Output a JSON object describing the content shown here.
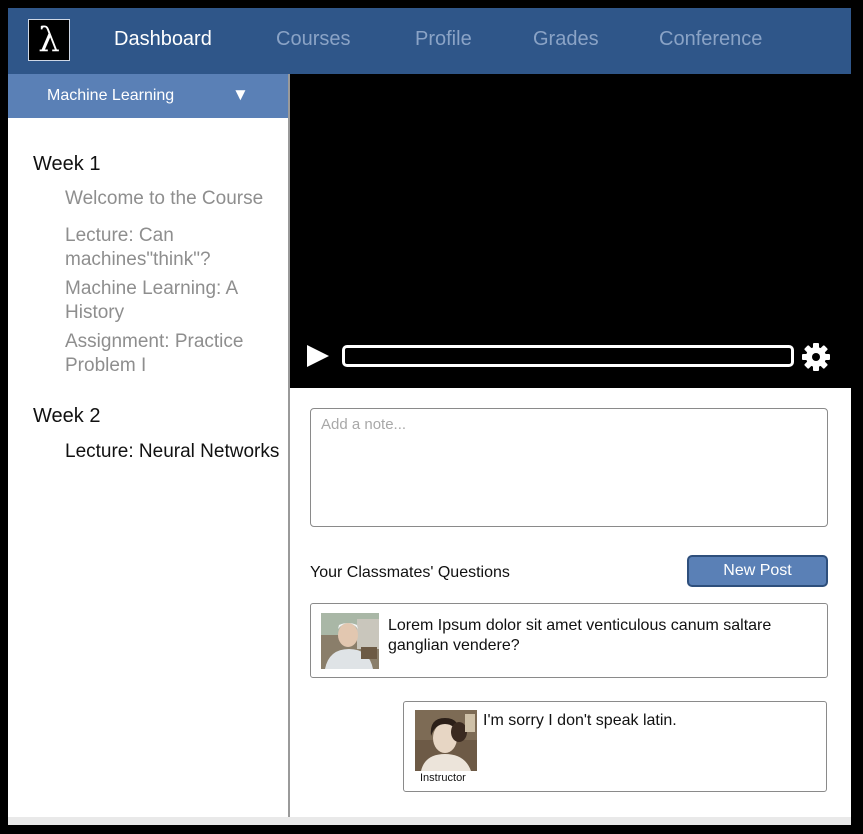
{
  "nav": {
    "logo": "λ",
    "items": [
      {
        "label": "Dashboard"
      },
      {
        "label": "Courses"
      },
      {
        "label": "Profile"
      },
      {
        "label": "Grades"
      },
      {
        "label": "Conference"
      }
    ],
    "active_color": "#ffffff",
    "inactive_color": "#8aa3c6",
    "bar_color": "#2f5689"
  },
  "sidebar": {
    "course_select": {
      "label": "Machine Learning",
      "caret": "▼"
    },
    "weeks": [
      {
        "title": "Week 1",
        "lessons": [
          {
            "title": "Welcome to the Course"
          },
          {
            "title": "Lecture: Can machines\"think\"?"
          },
          {
            "title": "Machine Learning: A History"
          },
          {
            "title": "Assignment: Practice Problem I"
          }
        ]
      },
      {
        "title": "Week 2",
        "lessons": [
          {
            "title": "Lecture: Neural Networks",
            "current": true
          }
        ]
      }
    ]
  },
  "video": {
    "play_icon": "play-icon",
    "settings_icon": "gear-icon"
  },
  "notes": {
    "placeholder": "Add a note...",
    "value": ""
  },
  "questions": {
    "heading": "Your Classmates' Questions",
    "new_post_label": "New Post",
    "posts": [
      {
        "text": "Lorem Ipsum dolor sit amet venticulous canum saltare ganglian vendere?"
      }
    ],
    "replies": [
      {
        "text": "I'm sorry I don't speak latin.",
        "role": "Instructor"
      }
    ]
  },
  "colors": {
    "accent": "#5a80b6",
    "accent_border": "#2e4f7c"
  }
}
